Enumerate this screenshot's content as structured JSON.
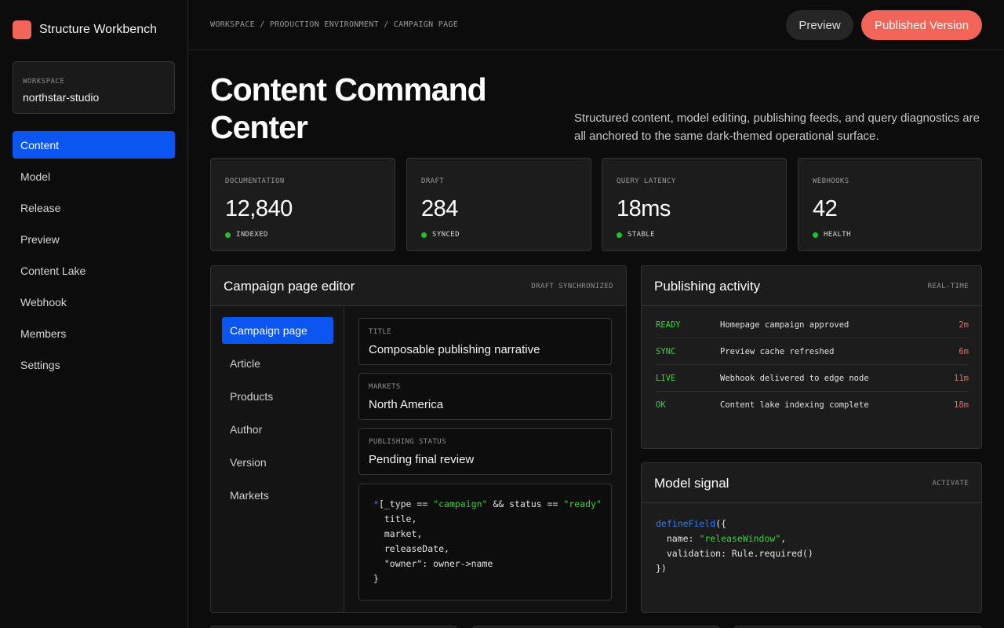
{
  "app": {
    "name": "Structure Workbench",
    "accent": "#f36458",
    "primary": "#0b55f0"
  },
  "workspace": {
    "label": "WORKSPACE",
    "value": "northstar-studio"
  },
  "sidebar": {
    "items": [
      {
        "label": "Content",
        "active": true
      },
      {
        "label": "Model"
      },
      {
        "label": "Release"
      },
      {
        "label": "Preview"
      },
      {
        "label": "Content Lake"
      },
      {
        "label": "Webhook"
      },
      {
        "label": "Members"
      },
      {
        "label": "Settings"
      }
    ]
  },
  "header": {
    "breadcrumb": "WORKSPACE / PRODUCTION ENVIRONMENT / CAMPAIGN PAGE",
    "preview_label": "Preview",
    "publish_label": "Published Version"
  },
  "hero": {
    "title_line1": "Content Command",
    "title_line2": "Center",
    "description": "Structured content, model editing, publishing feeds, and query diagnostics are all anchored to the same dark-themed operational surface."
  },
  "stats": [
    {
      "label": "DOCUMENTATION",
      "value": "12,840",
      "status": "INDEXED"
    },
    {
      "label": "DRAFT",
      "value": "284",
      "status": "SYNCED"
    },
    {
      "label": "QUERY LATENCY",
      "value": "18ms",
      "status": "STABLE"
    },
    {
      "label": "WEBHOOKS",
      "value": "42",
      "status": "HEALTH"
    }
  ],
  "editor": {
    "title": "Campaign page editor",
    "tag": "DRAFT SYNCHRONIZED",
    "documents": [
      "Campaign page",
      "Article",
      "Products",
      "Author",
      "Version",
      "Markets"
    ],
    "fields": [
      {
        "label": "TITLE",
        "value": "Composable publishing narrative"
      },
      {
        "label": "MARKETS",
        "value": "North America"
      },
      {
        "label": "PUBLISHING STATUS",
        "value": "Pending final review"
      }
    ],
    "query": {
      "star": "*",
      "open": "[_type == ",
      "type_value": "\"campaign\"",
      "mid": " && status == ",
      "status_value": "\"ready\"",
      "lines": [
        "  title,",
        "  market,",
        "  releaseDate,",
        "  \"owner\": owner->name",
        "}"
      ]
    }
  },
  "activity": {
    "title": "Publishing activity",
    "tag": "REAL-TIME",
    "rows": [
      {
        "status": "READY",
        "text": "Homepage campaign approved",
        "time": "2m"
      },
      {
        "status": "SYNC",
        "text": "Preview cache refreshed",
        "time": "6m"
      },
      {
        "status": "LIVE",
        "text": "Webhook delivered to edge node",
        "time": "11m"
      },
      {
        "status": "OK",
        "text": "Content lake indexing complete",
        "time": "18m"
      }
    ]
  },
  "model_signal": {
    "title": "Model signal",
    "tag": "ACTIVATE",
    "fn": "defineField",
    "open": "({",
    "name_key": "  name: ",
    "name_value": "\"releaseWindow\"",
    "name_end": ",",
    "validation": "  validation: Rule.required()",
    "close": "})"
  }
}
